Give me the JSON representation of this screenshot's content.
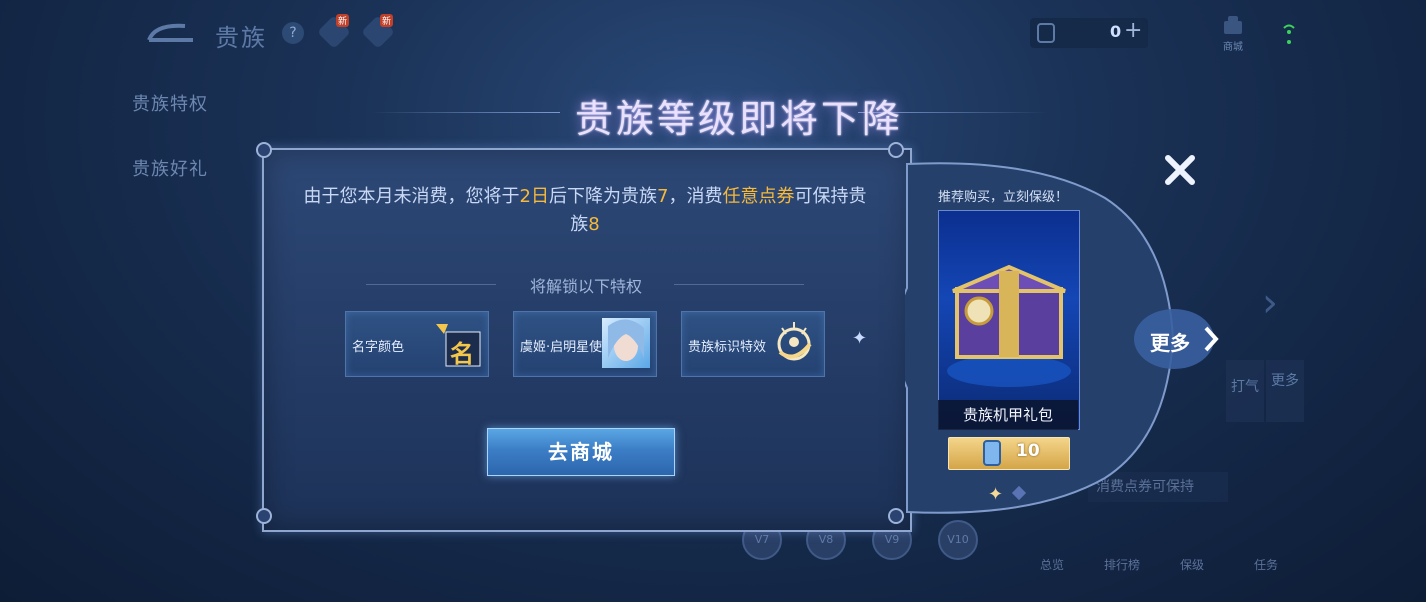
{
  "topbar": {
    "title": "贵族",
    "help": "?",
    "new_badge_1": "新",
    "new_badge_2": "新",
    "coin_value": "0",
    "shop_label": "商城"
  },
  "side_menu": {
    "items": [
      {
        "label": "贵族特权"
      },
      {
        "label": "贵族好礼"
      }
    ]
  },
  "dialog": {
    "title": "贵族等级即将下降",
    "message_parts": {
      "p1": "由于您本月未消费，您将于",
      "p2": "2日",
      "p3": "后下降为贵族",
      "p4": "7",
      "p5": "，消费",
      "p6": "任意点券",
      "p7": "可保持贵族",
      "p8": "8"
    },
    "unlock_title": "将解锁以下特权",
    "perks": [
      {
        "label": "名字颜色",
        "icon": "name-color-icon",
        "icon_text": "名"
      },
      {
        "label": "虞姬·启明星使",
        "icon": "skin-portrait-icon"
      },
      {
        "label": "贵族标识特效",
        "icon": "noble-emblem-icon"
      }
    ],
    "go_button": "去商城"
  },
  "recommend": {
    "tagline": "推荐购买，立刻保级！",
    "pack_name": "贵族机甲礼包",
    "price": "10",
    "more_label": "更多"
  },
  "background": {
    "hint": "消费点券可保持",
    "badges": [
      "V7",
      "V8",
      "V9",
      "V10"
    ],
    "bottom_labels": [
      "总览",
      "排行榜",
      "保级",
      "任务"
    ],
    "side_buttons": [
      "打气",
      "更多"
    ]
  },
  "colors": {
    "highlight": "#f6b93b",
    "panel_border": "#8fa7cf",
    "button_blue": "#3c7ec6"
  }
}
